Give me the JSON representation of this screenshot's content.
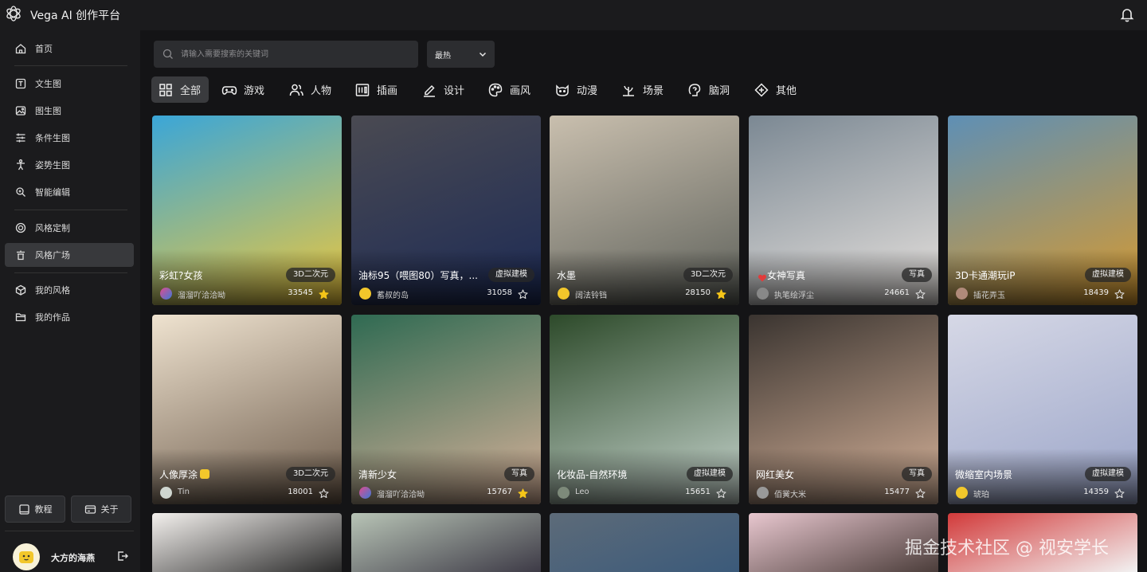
{
  "app": {
    "title": "Vega AI 创作平台"
  },
  "sidebar": {
    "items": [
      {
        "label": "首页",
        "icon": "home-icon"
      },
      {
        "label": "文生图",
        "icon": "text-icon"
      },
      {
        "label": "图生图",
        "icon": "image-icon"
      },
      {
        "label": "条件生图",
        "icon": "sliders-icon"
      },
      {
        "label": "姿势生图",
        "icon": "pose-icon"
      },
      {
        "label": "智能编辑",
        "icon": "edit-icon"
      },
      {
        "label": "风格定制",
        "icon": "target-icon"
      },
      {
        "label": "风格广场",
        "icon": "plaza-icon",
        "active": true
      },
      {
        "label": "我的风格",
        "icon": "cube-icon"
      },
      {
        "label": "我的作品",
        "icon": "folder-icon"
      }
    ],
    "buttons": {
      "tutorial": "教程",
      "about": "关于"
    },
    "user": {
      "name": "大方的海燕"
    }
  },
  "search": {
    "placeholder": "请输入需要搜索的关键词",
    "value": ""
  },
  "sort": {
    "selected": "最热"
  },
  "categories": [
    {
      "label": "全部",
      "icon": "grid-icon",
      "active": true
    },
    {
      "label": "游戏",
      "icon": "gamepad-icon"
    },
    {
      "label": "人物",
      "icon": "people-icon"
    },
    {
      "label": "插画",
      "icon": "illustration-icon"
    },
    {
      "label": "设计",
      "icon": "pen-icon"
    },
    {
      "label": "画风",
      "icon": "palette-icon"
    },
    {
      "label": "动漫",
      "icon": "anime-icon"
    },
    {
      "label": "场景",
      "icon": "plant-icon"
    },
    {
      "label": "脑洞",
      "icon": "brain-icon"
    },
    {
      "label": "其他",
      "icon": "diamond-icon"
    }
  ],
  "cards": [
    {
      "title": "彩虹?女孩",
      "tag": "3D二次元",
      "author": "溜溜吖洽洽呦",
      "count": "33545",
      "starred": true,
      "colors": [
        "#3aa6d8",
        "#f0c83a"
      ]
    },
    {
      "title": "油标95（喂图80）写真，...",
      "tag": "虚拟建模",
      "author": "蓄叔的岛",
      "count": "31058",
      "starred": false,
      "colors": [
        "#4a4a52",
        "#1c2a55"
      ]
    },
    {
      "title": "水墨",
      "tag": "3D二次元",
      "author": "阔法铃铛",
      "count": "28150",
      "starred": true,
      "colors": [
        "#c9bfae",
        "#5d605a"
      ]
    },
    {
      "title": "女神写真",
      "tag": "写真",
      "author": "执笔绘浮尘",
      "count": "24661",
      "starred": false,
      "heart": true,
      "colors": [
        "#7b8893",
        "#e8e3df"
      ]
    },
    {
      "title": "3D卡通潮玩iP",
      "tag": "虚拟建模",
      "author": "插花弄玉",
      "count": "18439",
      "starred": false,
      "colors": [
        "#5e8fb5",
        "#d89a2e"
      ]
    },
    {
      "title": "人像厚涂",
      "tag": "3D二次元",
      "author": "Tin",
      "count": "18001",
      "starred": false,
      "badge": true,
      "colors": [
        "#efe3d0",
        "#6a5848"
      ]
    },
    {
      "title": "清新少女",
      "tag": "写真",
      "author": "溜溜吖洽洽呦",
      "count": "15767",
      "starred": true,
      "colors": [
        "#2f6a52",
        "#d9b29a"
      ]
    },
    {
      "title": "化妆品-自然环境",
      "tag": "虚拟建模",
      "author": "Leo",
      "count": "15651",
      "starred": false,
      "colors": [
        "#2d4a2a",
        "#c8d6cf"
      ]
    },
    {
      "title": "网红美女",
      "tag": "写真",
      "author": "佰黉大米",
      "count": "15477",
      "starred": false,
      "colors": [
        "#3a3430",
        "#d7b39a"
      ]
    },
    {
      "title": "微缩室内场景",
      "tag": "虚拟建模",
      "author": "琥珀",
      "count": "14359",
      "starred": false,
      "colors": [
        "#d6d8e6",
        "#9aa4c8"
      ]
    }
  ],
  "partial_cards": [
    {
      "colors": [
        "#f4f1ee",
        "#2a2a2a"
      ]
    },
    {
      "colors": [
        "#b8c4b6",
        "#3d3a46"
      ]
    },
    {
      "colors": [
        "#5d6b79",
        "#3b5a7a"
      ]
    },
    {
      "colors": [
        "#e8c7cf",
        "#4b3d3a"
      ]
    },
    {
      "colors": [
        "#d23a3a",
        "#f2f2f2"
      ]
    }
  ],
  "watermark": "掘金技术社区 @ 视安学长"
}
